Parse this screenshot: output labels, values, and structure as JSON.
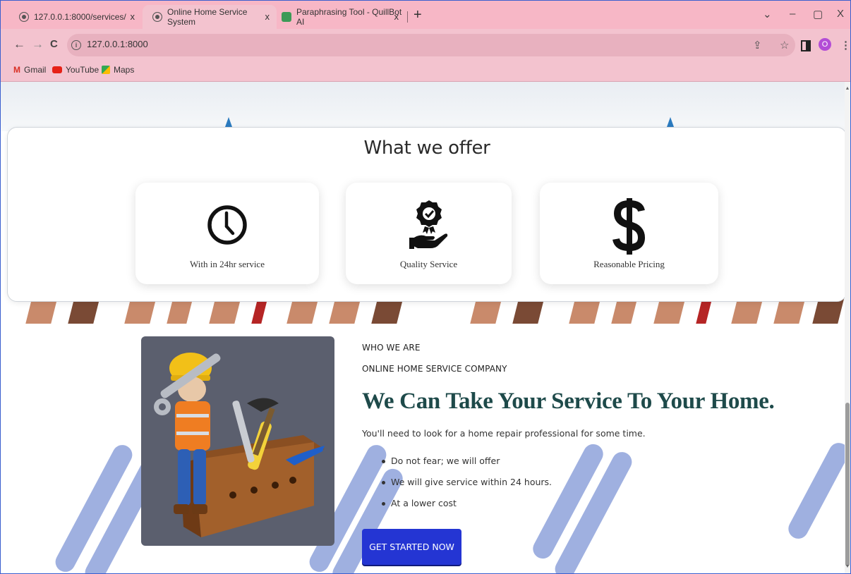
{
  "browser": {
    "tabs": [
      {
        "title": "127.0.0.1:8000/services/",
        "active": false
      },
      {
        "title": "Online Home Service System",
        "active": true
      },
      {
        "title": "Paraphrasing Tool - QuillBot AI",
        "active": false
      }
    ],
    "close_glyph": "x",
    "new_tab_glyph": "+",
    "window_controls": {
      "tab_search": "⌄",
      "minimize": "–",
      "maximize": "▢",
      "close": "X"
    },
    "nav": {
      "back": "←",
      "forward": "→",
      "reload": "C"
    },
    "url": "127.0.0.1:8000",
    "profile_initial": "O",
    "bookmarks": [
      {
        "label": "Gmail",
        "icon": "gmail-icon"
      },
      {
        "label": "YouTube",
        "icon": "youtube-icon"
      },
      {
        "label": "Maps",
        "icon": "maps-icon"
      }
    ]
  },
  "offer": {
    "title": "What we offer",
    "items": [
      {
        "label": "With in 24hr service",
        "icon": "clock-icon"
      },
      {
        "label": "Quality Service",
        "icon": "quality-badge-hand-icon"
      },
      {
        "label": "Reasonable Pricing",
        "icon": "dollar-icon"
      }
    ]
  },
  "who": {
    "eyebrow": "WHO WE ARE",
    "subtitle": "ONLINE HOME SERVICE COMPANY",
    "heading": "We Can Take Your Service To Your Home.",
    "paragraph": "You'll need to look for a home repair professional for some time.",
    "bullets": [
      "Do not fear; we will offer",
      "We will give service within 24 hours.",
      "At a lower cost"
    ],
    "cta_label": "GET STARTED NOW"
  },
  "colors": {
    "chrome_pink": "#f3c3cf",
    "heading_teal": "#1e4a4a",
    "cta_blue": "#2435d3",
    "stripe_blue": "#9fb0e0"
  }
}
